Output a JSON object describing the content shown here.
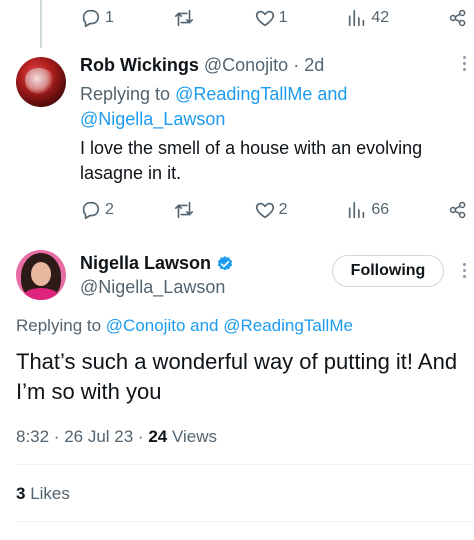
{
  "colors": {
    "link": "#1d9bf0",
    "muted": "#536471",
    "text": "#0f1419",
    "verified": "#1d9bf0"
  },
  "top_actions": {
    "replies": "1",
    "likes": "1",
    "views": "42"
  },
  "reply": {
    "name": "Rob Wickings",
    "handle": "@Conojito",
    "sep": " · ",
    "time": "2d",
    "replying_prefix": "Replying to ",
    "mention1": "@ReadingTallMe",
    "and": " and ",
    "mention2": "@Nigella_Lawson",
    "text": "I love the smell of a house with an evolving lasagne in it.",
    "actions": {
      "replies": "2",
      "likes": "2",
      "views": "66"
    }
  },
  "main": {
    "name": "Nigella Lawson",
    "handle": "@Nigella_Lawson",
    "follow_label": "Following",
    "replying_prefix": "Replying to ",
    "mention1": "@Conojito",
    "and": " and ",
    "mention2": "@ReadingTallMe",
    "text": "That’s such a wonderful way of putting it! And I’m so with you",
    "time": "8:32 · 26 Jul 23 · ",
    "views_count": "24",
    "views_label": " Views",
    "likes_count": "3",
    "likes_label": " Likes"
  },
  "icons": [
    "reply-icon",
    "retweet-icon",
    "like-icon",
    "views-icon",
    "share-icon",
    "verified-badge-icon",
    "more-icon"
  ]
}
